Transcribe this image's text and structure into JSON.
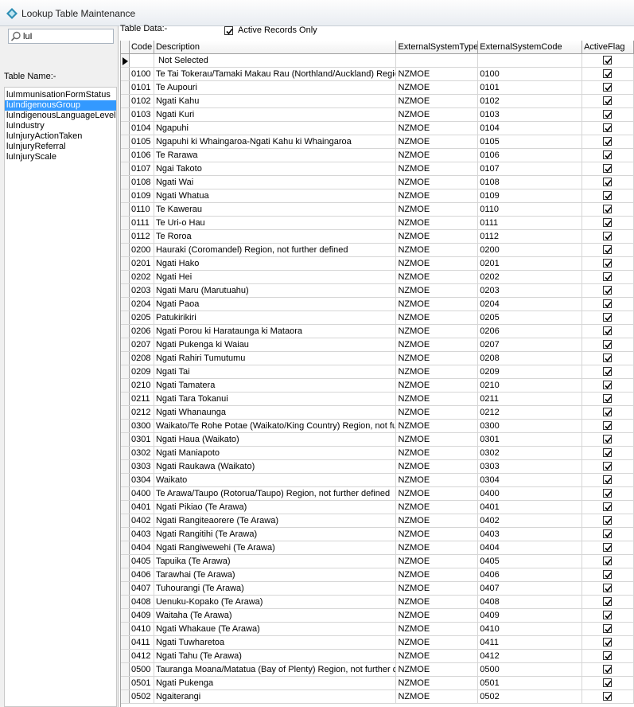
{
  "window": {
    "title": "Lookup Table Maintenance"
  },
  "search": {
    "value": "luI"
  },
  "left": {
    "table_name_label": "Table Name:-",
    "items": [
      {
        "label": "luImmunisationFormStatus",
        "selected": false
      },
      {
        "label": "luIndigenousGroup",
        "selected": true
      },
      {
        "label": "luIndigenousLanguageLevel",
        "selected": false
      },
      {
        "label": "luIndustry",
        "selected": false
      },
      {
        "label": "luInjuryActionTaken",
        "selected": false
      },
      {
        "label": "luInjuryReferral",
        "selected": false
      },
      {
        "label": "luInjuryScale",
        "selected": false
      }
    ]
  },
  "table_data_label": "Table Data:-",
  "active_only": {
    "label": "Active Records Only",
    "checked": true
  },
  "grid": {
    "headers": {
      "code": "Code",
      "description": "Description",
      "ext_type": "ExternalSystemType",
      "ext_code": "ExternalSystemCode",
      "flag": "ActiveFlag"
    },
    "rows": [
      {
        "code": "",
        "description": "Not Selected",
        "ext_type": "",
        "ext_code": "",
        "active": true,
        "current": true
      },
      {
        "code": "0100",
        "description": "Te Tai Tokerau/Tamaki Makau Rau (Northland/Auckland) Region",
        "ext_type": "NZMOE",
        "ext_code": "0100",
        "active": true
      },
      {
        "code": "0101",
        "description": "Te Aupouri",
        "ext_type": "NZMOE",
        "ext_code": "0101",
        "active": true
      },
      {
        "code": "0102",
        "description": "Ngati Kahu",
        "ext_type": "NZMOE",
        "ext_code": "0102",
        "active": true
      },
      {
        "code": "0103",
        "description": "Ngati Kuri",
        "ext_type": "NZMOE",
        "ext_code": "0103",
        "active": true
      },
      {
        "code": "0104",
        "description": "Ngapuhi",
        "ext_type": "NZMOE",
        "ext_code": "0104",
        "active": true
      },
      {
        "code": "0105",
        "description": "Ngapuhi ki Whaingaroa-Ngati Kahu ki Whaingaroa",
        "ext_type": "NZMOE",
        "ext_code": "0105",
        "active": true
      },
      {
        "code": "0106",
        "description": "Te Rarawa",
        "ext_type": "NZMOE",
        "ext_code": "0106",
        "active": true
      },
      {
        "code": "0107",
        "description": "Ngai Takoto",
        "ext_type": "NZMOE",
        "ext_code": "0107",
        "active": true
      },
      {
        "code": "0108",
        "description": "Ngati Wai",
        "ext_type": "NZMOE",
        "ext_code": "0108",
        "active": true
      },
      {
        "code": "0109",
        "description": "Ngati Whatua",
        "ext_type": "NZMOE",
        "ext_code": "0109",
        "active": true
      },
      {
        "code": "0110",
        "description": "Te Kawerau",
        "ext_type": "NZMOE",
        "ext_code": "0110",
        "active": true
      },
      {
        "code": "0111",
        "description": "Te Uri-o Hau",
        "ext_type": "NZMOE",
        "ext_code": "0111",
        "active": true
      },
      {
        "code": "0112",
        "description": "Te Roroa",
        "ext_type": "NZMOE",
        "ext_code": "0112",
        "active": true
      },
      {
        "code": "0200",
        "description": "Hauraki (Coromandel) Region, not further defined",
        "ext_type": "NZMOE",
        "ext_code": "0200",
        "active": true
      },
      {
        "code": "0201",
        "description": "Ngati Hako",
        "ext_type": "NZMOE",
        "ext_code": "0201",
        "active": true
      },
      {
        "code": "0202",
        "description": "Ngati Hei",
        "ext_type": "NZMOE",
        "ext_code": "0202",
        "active": true
      },
      {
        "code": "0203",
        "description": "Ngati Maru (Marutuahu)",
        "ext_type": "NZMOE",
        "ext_code": "0203",
        "active": true
      },
      {
        "code": "0204",
        "description": "Ngati Paoa",
        "ext_type": "NZMOE",
        "ext_code": "0204",
        "active": true
      },
      {
        "code": "0205",
        "description": "Patukirikiri",
        "ext_type": "NZMOE",
        "ext_code": "0205",
        "active": true
      },
      {
        "code": "0206",
        "description": "Ngati Porou ki Harataunga ki Mataora",
        "ext_type": "NZMOE",
        "ext_code": "0206",
        "active": true
      },
      {
        "code": "0207",
        "description": "Ngati Pukenga ki Waiau",
        "ext_type": "NZMOE",
        "ext_code": "0207",
        "active": true
      },
      {
        "code": "0208",
        "description": "Ngati Rahiri Tumutumu",
        "ext_type": "NZMOE",
        "ext_code": "0208",
        "active": true
      },
      {
        "code": "0209",
        "description": "Ngati Tai",
        "ext_type": "NZMOE",
        "ext_code": "0209",
        "active": true
      },
      {
        "code": "0210",
        "description": "Ngati Tamatera",
        "ext_type": "NZMOE",
        "ext_code": "0210",
        "active": true
      },
      {
        "code": "0211",
        "description": "Ngati Tara Tokanui",
        "ext_type": "NZMOE",
        "ext_code": "0211",
        "active": true
      },
      {
        "code": "0212",
        "description": "Ngati Whanaunga",
        "ext_type": "NZMOE",
        "ext_code": "0212",
        "active": true
      },
      {
        "code": "0300",
        "description": "Waikato/Te Rohe Potae (Waikato/King Country) Region, not further defined",
        "ext_type": "NZMOE",
        "ext_code": "0300",
        "active": true
      },
      {
        "code": "0301",
        "description": "Ngati Haua (Waikato)",
        "ext_type": "NZMOE",
        "ext_code": "0301",
        "active": true
      },
      {
        "code": "0302",
        "description": "Ngati Maniapoto",
        "ext_type": "NZMOE",
        "ext_code": "0302",
        "active": true
      },
      {
        "code": "0303",
        "description": "Ngati Raukawa (Waikato)",
        "ext_type": "NZMOE",
        "ext_code": "0303",
        "active": true
      },
      {
        "code": "0304",
        "description": "Waikato",
        "ext_type": "NZMOE",
        "ext_code": "0304",
        "active": true
      },
      {
        "code": "0400",
        "description": "Te Arawa/Taupo (Rotorua/Taupo) Region, not further defined",
        "ext_type": "NZMOE",
        "ext_code": "0400",
        "active": true
      },
      {
        "code": "0401",
        "description": "Ngati Pikiao (Te Arawa)",
        "ext_type": "NZMOE",
        "ext_code": "0401",
        "active": true
      },
      {
        "code": "0402",
        "description": "Ngati Rangiteaorere (Te Arawa)",
        "ext_type": "NZMOE",
        "ext_code": "0402",
        "active": true
      },
      {
        "code": "0403",
        "description": "Ngati Rangitihi (Te Arawa)",
        "ext_type": "NZMOE",
        "ext_code": "0403",
        "active": true
      },
      {
        "code": "0404",
        "description": "Ngati Rangiwewehi (Te Arawa)",
        "ext_type": "NZMOE",
        "ext_code": "0404",
        "active": true
      },
      {
        "code": "0405",
        "description": "Tapuika (Te Arawa)",
        "ext_type": "NZMOE",
        "ext_code": "0405",
        "active": true
      },
      {
        "code": "0406",
        "description": "Tarawhai (Te Arawa)",
        "ext_type": "NZMOE",
        "ext_code": "0406",
        "active": true
      },
      {
        "code": "0407",
        "description": "Tuhourangi (Te Arawa)",
        "ext_type": "NZMOE",
        "ext_code": "0407",
        "active": true
      },
      {
        "code": "0408",
        "description": "Uenuku-Kopako (Te Arawa)",
        "ext_type": "NZMOE",
        "ext_code": "0408",
        "active": true
      },
      {
        "code": "0409",
        "description": "Waitaha (Te Arawa)",
        "ext_type": "NZMOE",
        "ext_code": "0409",
        "active": true
      },
      {
        "code": "0410",
        "description": "Ngati Whakaue (Te Arawa)",
        "ext_type": "NZMOE",
        "ext_code": "0410",
        "active": true
      },
      {
        "code": "0411",
        "description": "Ngati Tuwharetoa",
        "ext_type": "NZMOE",
        "ext_code": "0411",
        "active": true
      },
      {
        "code": "0412",
        "description": "Ngati Tahu (Te Arawa)",
        "ext_type": "NZMOE",
        "ext_code": "0412",
        "active": true
      },
      {
        "code": "0500",
        "description": "Tauranga Moana/Matatua (Bay of Plenty) Region, not further defined",
        "ext_type": "NZMOE",
        "ext_code": "0500",
        "active": true
      },
      {
        "code": "0501",
        "description": "Ngati Pukenga",
        "ext_type": "NZMOE",
        "ext_code": "0501",
        "active": true
      },
      {
        "code": "0502",
        "description": "Ngaiterangi",
        "ext_type": "NZMOE",
        "ext_code": "0502",
        "active": true
      }
    ]
  }
}
